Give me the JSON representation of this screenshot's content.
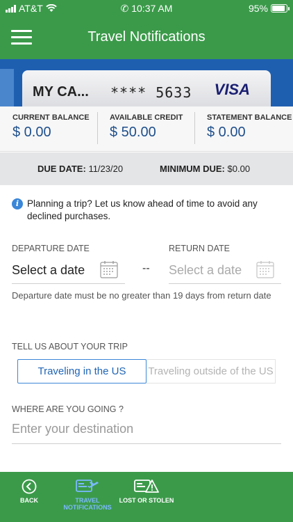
{
  "status": {
    "carrier": "AT&T",
    "time": "10:37 AM",
    "battery": "95%",
    "battery_level": 0.95
  },
  "header": {
    "title": "Travel Notifications"
  },
  "card": {
    "name": "MY CA...",
    "number": "**** 5633",
    "brand": "VISA"
  },
  "balances": [
    {
      "label": "CURRENT BALANCE",
      "value": "$ 0.00"
    },
    {
      "label": "AVAILABLE CREDIT",
      "value": "$ 50.00"
    },
    {
      "label": "STATEMENT BALANCE",
      "value": "$ 0.00"
    }
  ],
  "due": {
    "date_label": "DUE DATE:",
    "date_value": "11/23/20",
    "min_label": "MINIMUM DUE:",
    "min_value": "$0.00"
  },
  "info": {
    "text": "Planning a trip? Let us know ahead of time to avoid any declined purchases."
  },
  "departure": {
    "label": "DEPARTURE DATE",
    "value": "Select a date"
  },
  "return": {
    "label": "RETURN DATE",
    "placeholder": "Select a date"
  },
  "dash": "--",
  "hint": "Departure date must be no greater than 19 days from return date",
  "trip": {
    "label": "TELL US ABOUT YOUR TRIP",
    "options": [
      "Traveling in the US",
      "Traveling outside of the US"
    ],
    "selected": "Traveling in the US"
  },
  "destination": {
    "label": "WHERE ARE YOU GOING ?",
    "placeholder": "Enter your destination"
  },
  "nav": [
    {
      "label": "BACK",
      "icon": "back-arrow-icon"
    },
    {
      "label": "TRAVEL NOTIFICATIONS",
      "icon": "travel-card-plane-icon",
      "active": true
    },
    {
      "label": "LOST OR STOLEN",
      "icon": "lost-card-warning-icon"
    }
  ]
}
